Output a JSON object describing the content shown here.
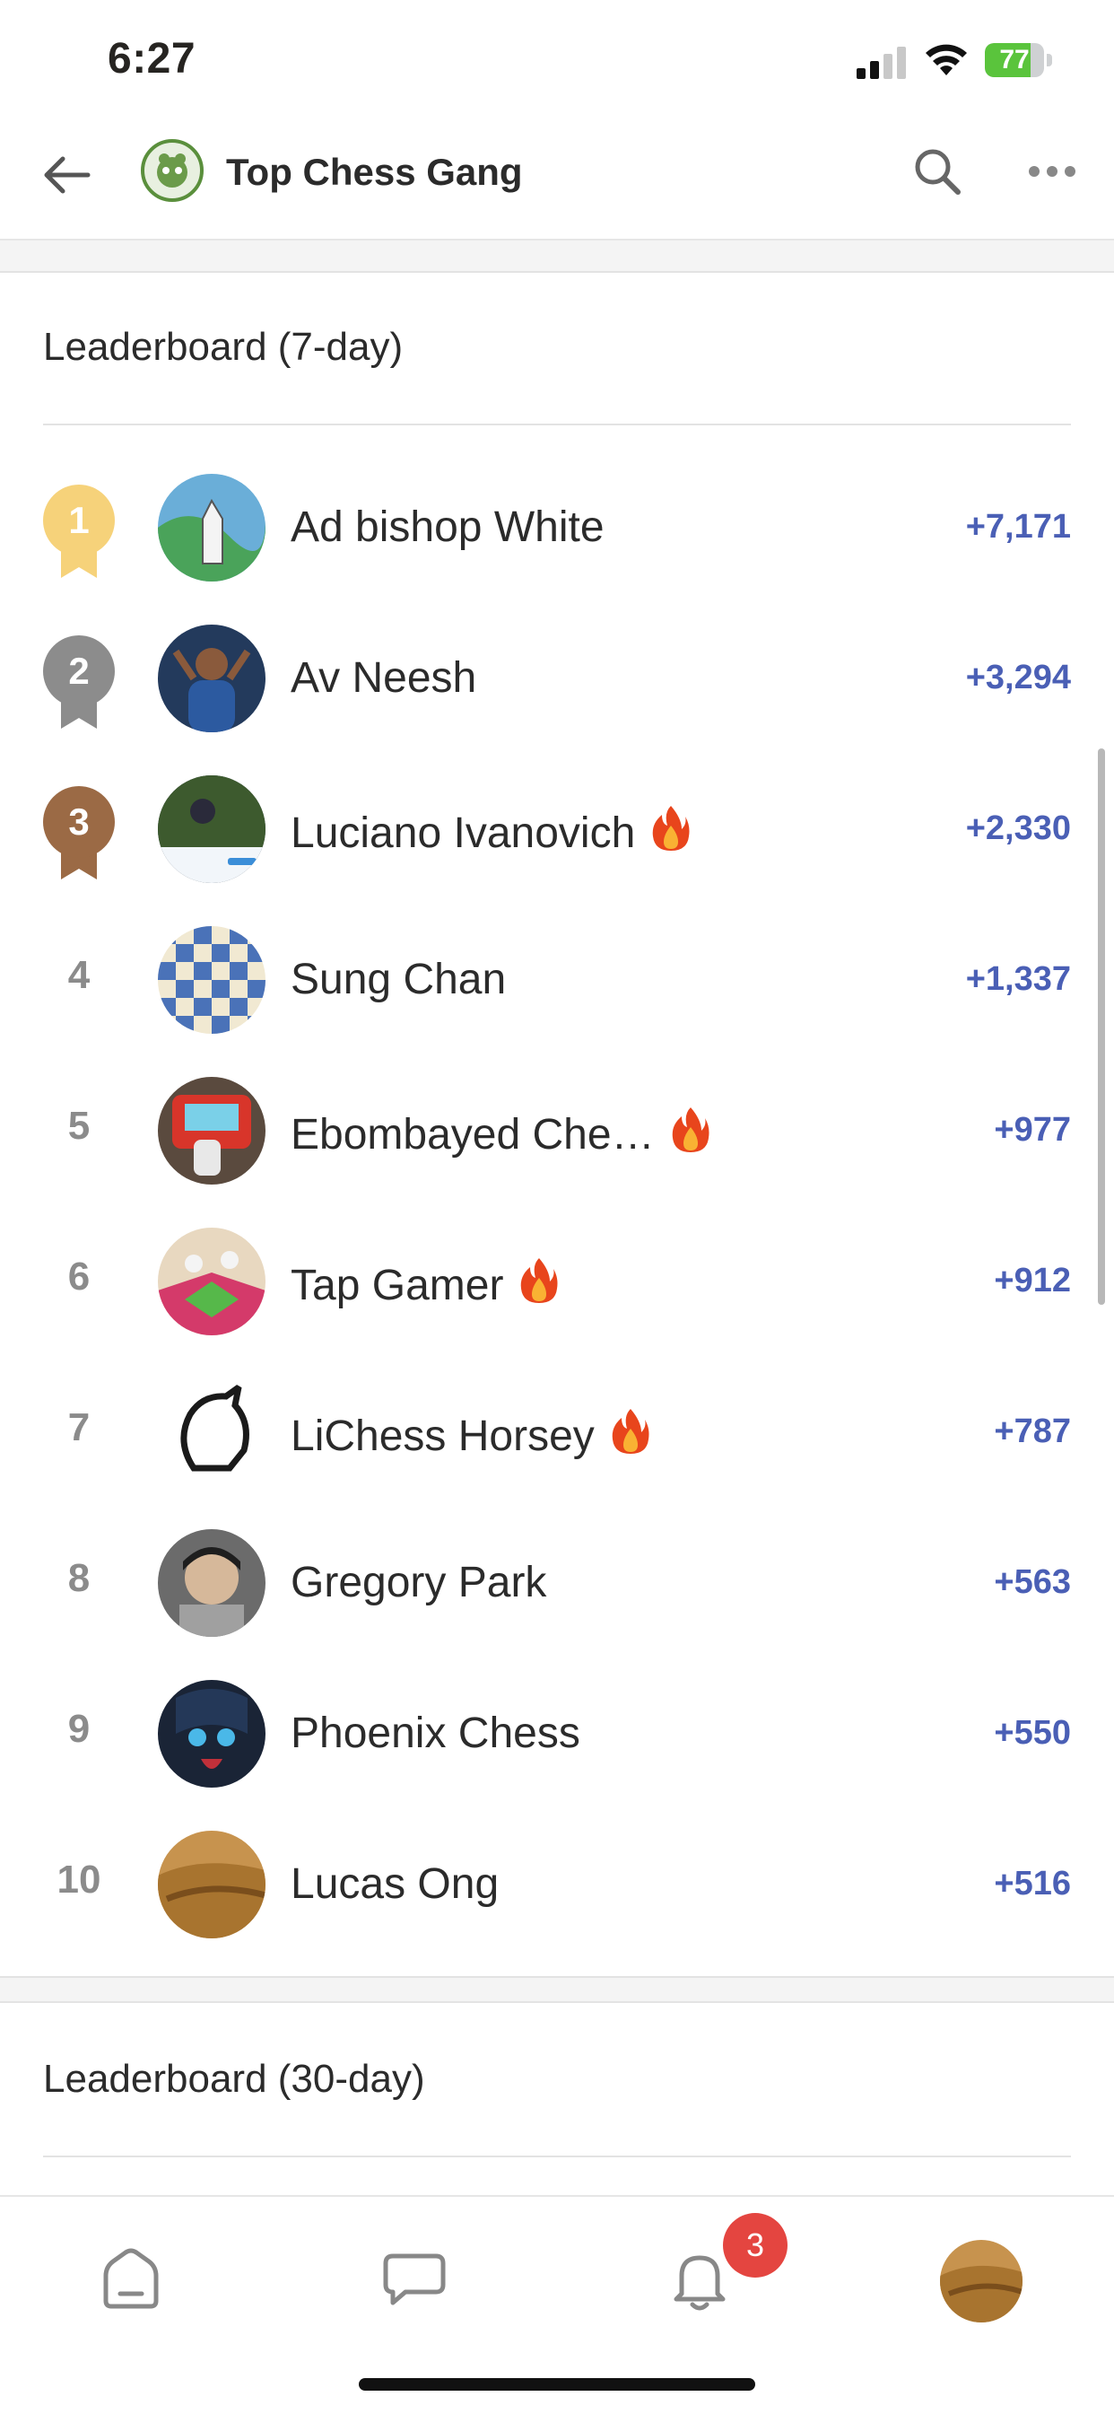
{
  "status_bar": {
    "time": "6:27",
    "battery": "77"
  },
  "header": {
    "club_name": "Top Chess Gang"
  },
  "leaderboard_7day": {
    "title": "Leaderboard (7-day)",
    "entries": [
      {
        "rank": "1",
        "name": "Ad bishop White",
        "score": "+7,171",
        "fire": false,
        "medal": "gold"
      },
      {
        "rank": "2",
        "name": "Av Neesh",
        "score": "+3,294",
        "fire": false,
        "medal": "silver"
      },
      {
        "rank": "3",
        "name": "Luciano Ivanovich",
        "score": "+2,330",
        "fire": true,
        "medal": "bronze"
      },
      {
        "rank": "4",
        "name": "Sung Chan",
        "score": "+1,337",
        "fire": false
      },
      {
        "rank": "5",
        "name": "Ebombayed Che…",
        "score": "+977",
        "fire": true
      },
      {
        "rank": "6",
        "name": "Tap Gamer",
        "score": "+912",
        "fire": true
      },
      {
        "rank": "7",
        "name": "LiChess Horsey",
        "score": "+787",
        "fire": true
      },
      {
        "rank": "8",
        "name": "Gregory Park",
        "score": "+563",
        "fire": false
      },
      {
        "rank": "9",
        "name": "Phoenix Chess",
        "score": "+550",
        "fire": false
      },
      {
        "rank": "10",
        "name": "Lucas Ong",
        "score": "+516",
        "fire": false
      }
    ]
  },
  "leaderboard_30day": {
    "title": "Leaderboard (30-day)"
  },
  "bottom_nav": {
    "notification_count": "3"
  },
  "colors": {
    "gold": "#f6d27a",
    "silver": "#8c8c8c",
    "bronze": "#9b6a45",
    "score": "#4a5fb5",
    "badge": "#e44540"
  },
  "icons": [
    "back-arrow-icon",
    "club-logo-icon",
    "search-icon",
    "more-dots-icon",
    "fire-icon",
    "home-icon",
    "chat-icon",
    "bell-icon"
  ]
}
